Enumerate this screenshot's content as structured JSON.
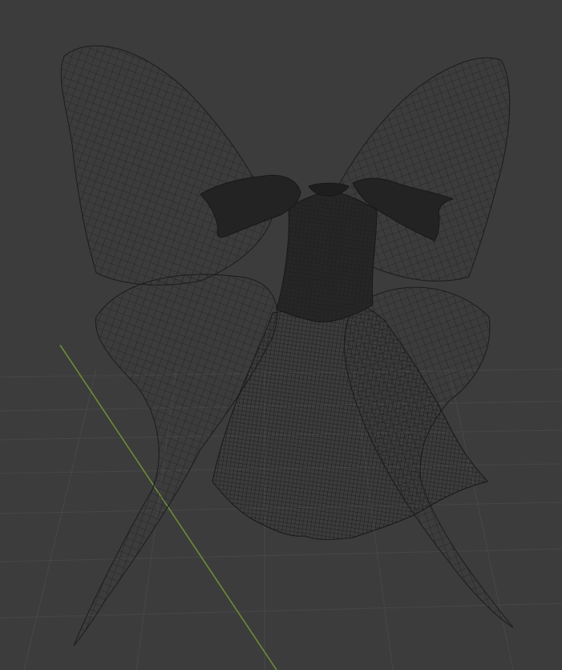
{
  "viewport": {
    "mode": "wireframe",
    "background_color": "#3c3c3c",
    "floor_grid_color": "#474747",
    "y_axis_color": "#6a8a3a",
    "wire_color": "#1a1a1a",
    "solid_color": "#262626",
    "objects": [
      "fairy-wings",
      "dress"
    ]
  }
}
